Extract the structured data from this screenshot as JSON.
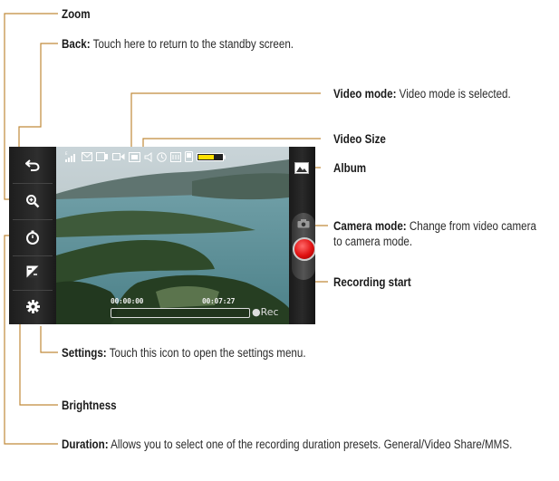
{
  "callouts": {
    "zoom": {
      "title": "Zoom",
      "text": ""
    },
    "back": {
      "title": "Back:",
      "text": " Touch here to return to the standby screen."
    },
    "video_mode": {
      "title": "Video mode:",
      "text": " Video mode is selected."
    },
    "video_size": {
      "title": "Video Size",
      "text": ""
    },
    "album": {
      "title": "Album",
      "text": ""
    },
    "camera_mode": {
      "title": "Camera mode:",
      "text": " Change from video camera to camera mode."
    },
    "recording_start": {
      "title": "Recording start",
      "text": ""
    },
    "settings": {
      "title": "Settings:",
      "text": " Touch this icon to open the settings menu."
    },
    "brightness": {
      "title": "Brightness",
      "text": ""
    },
    "duration": {
      "title": "Duration:",
      "text": " Allows you to select one of the recording duration presets. General/Video Share/MMS."
    }
  },
  "screen": {
    "elapsed_time": "00:00:00",
    "total_time": "00:07:27",
    "rec_label": "Rec"
  },
  "icons": [
    "back-icon",
    "zoom-icon",
    "timer-icon",
    "brightness-icon",
    "gear-icon",
    "album-icon",
    "camera-icon",
    "record-icon"
  ],
  "colors": {
    "record_red": "#e01010",
    "battery_yellow": "#ffe000",
    "callout_line": "#c08a3a"
  }
}
